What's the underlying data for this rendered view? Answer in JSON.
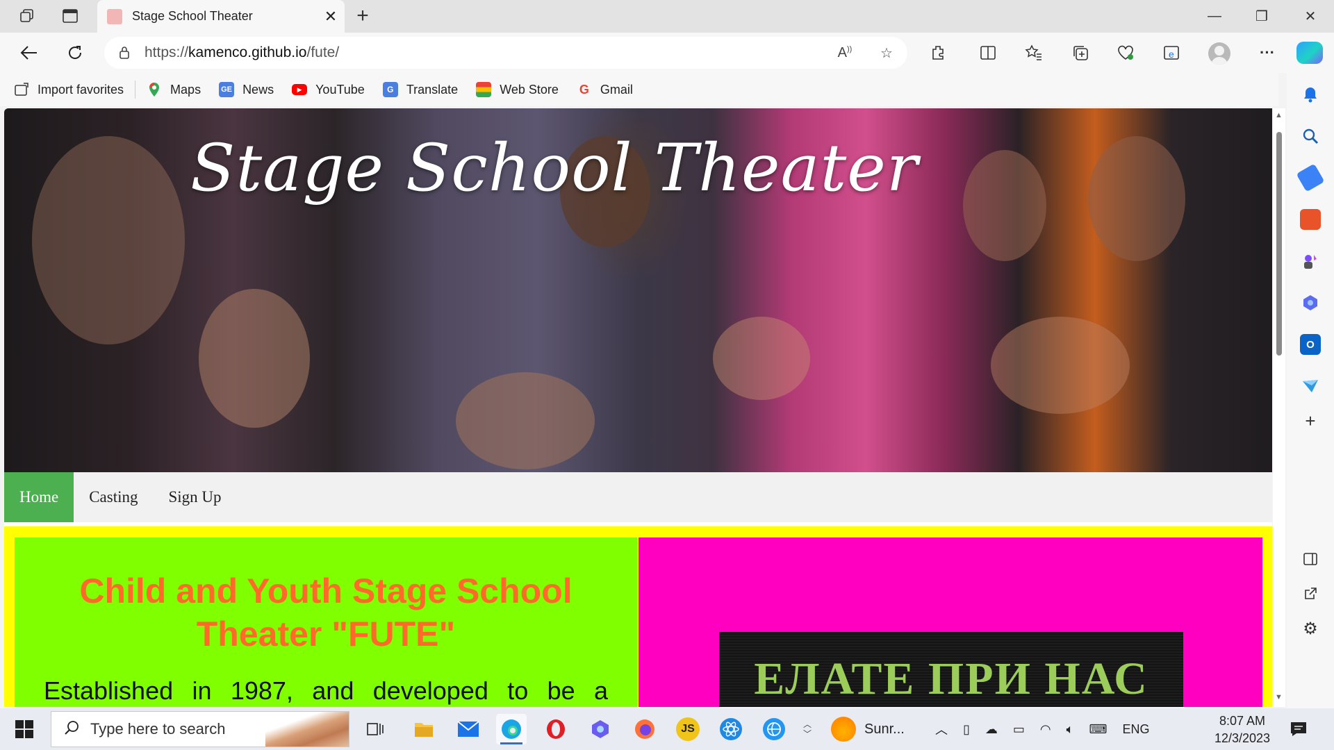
{
  "browser": {
    "tab_title": "Stage School Theater",
    "url_prefix": "https://",
    "url_host": "kamenco.github.io",
    "url_path": "/fute/",
    "favorites": [
      {
        "label": "Import favorites",
        "icon": "import-icon"
      },
      {
        "label": "Maps",
        "icon": "maps-icon"
      },
      {
        "label": "News",
        "icon": "news-icon"
      },
      {
        "label": "YouTube",
        "icon": "youtube-icon"
      },
      {
        "label": "Translate",
        "icon": "translate-icon"
      },
      {
        "label": "Web Store",
        "icon": "webstore-icon"
      },
      {
        "label": "Gmail",
        "icon": "google-icon"
      }
    ]
  },
  "page": {
    "hero_title": "Stage School Theater",
    "nav": [
      {
        "label": "Home",
        "active": true
      },
      {
        "label": "Casting",
        "active": false
      },
      {
        "label": "Sign Up",
        "active": false
      }
    ],
    "heading": "Child and Youth Stage School Theater \"FUTE\"",
    "intro_text": "Established in 1987, and developed to be a",
    "banner_text": "ЕЛАТЕ ПРИ НАС",
    "colors": {
      "nav_active": "#4caf50",
      "content_bg": "#ffff00",
      "left_col": "#80ff00",
      "right_col": "#ff00c0",
      "heading": "#ff6a2b",
      "banner_text": "#9ccc5a"
    }
  },
  "taskbar": {
    "search_placeholder": "Type here to search",
    "weather_label": "Sunr...",
    "language": "ENG",
    "time": "8:07 AM",
    "date": "12/3/2023"
  }
}
